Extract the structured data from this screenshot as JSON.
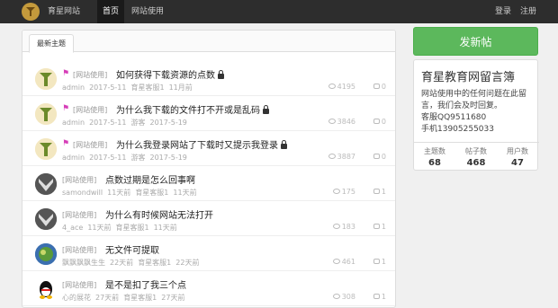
{
  "nav": {
    "brand": "育星网站",
    "home": "首页",
    "help": "网站使用",
    "login": "登录",
    "register": "注册"
  },
  "tabs": {
    "latest": "最新主题"
  },
  "topics": [
    {
      "category": "[网站使用]",
      "title": "如何获得下载资源的点数",
      "author": "admin",
      "date": "2017-5-11",
      "last_replier": "育星客服1",
      "ago": "11月前",
      "views": "4195",
      "replies": "0",
      "avatar": "tree",
      "flag": true,
      "lock": true
    },
    {
      "category": "[网站使用]",
      "title": "为什么我下载的文件打不开或是乱码",
      "author": "admin",
      "date": "2017-5-11",
      "last_replier": "游客",
      "ago": "2017-5-19",
      "views": "3846",
      "replies": "0",
      "avatar": "tree",
      "flag": true,
      "lock": true
    },
    {
      "category": "[网站使用]",
      "title": "为什么我登录网站了下载时又提示我登录",
      "author": "admin",
      "date": "2017-5-11",
      "last_replier": "游客",
      "ago": "2017-5-19",
      "views": "3887",
      "replies": "0",
      "avatar": "tree",
      "flag": true,
      "lock": true
    },
    {
      "category": "[网站使用]",
      "title": "点数过期是怎么回事啊",
      "author": "samondwill",
      "date": "11天前",
      "last_replier": "育星客服1",
      "ago": "11天前",
      "views": "175",
      "replies": "1",
      "avatar": "mask",
      "flag": false,
      "lock": false
    },
    {
      "category": "[网站使用]",
      "title": "为什么有时候网站无法打开",
      "author": "4_ace",
      "date": "11天前",
      "last_replier": "育星客服1",
      "ago": "11天前",
      "views": "183",
      "replies": "1",
      "avatar": "mask",
      "flag": false,
      "lock": false
    },
    {
      "category": "[网站使用]",
      "title": "无文件可提取",
      "author": "飘飘飘飘生生",
      "date": "22天前",
      "last_replier": "育星客服1",
      "ago": "22天前",
      "views": "461",
      "replies": "1",
      "avatar": "globe",
      "flag": false,
      "lock": false
    },
    {
      "category": "[网站使用]",
      "title": "是不是扣了我三个点",
      "author": "心的展花",
      "date": "27天前",
      "last_replier": "育星客服1",
      "ago": "27天前",
      "views": "308",
      "replies": "1",
      "avatar": "qq",
      "flag": false,
      "lock": false
    }
  ],
  "sidebar": {
    "new_post": "发新帖",
    "board_title": "育星教育网留言簿",
    "desc_line1": "网站使用中的任何问题在此留",
    "desc_line2": "言，我们会及时回复。",
    "desc_line3": "客服QQ9511680",
    "desc_line4": "手机13905255033",
    "stats": [
      {
        "label": "主题数",
        "value": "68"
      },
      {
        "label": "帖子数",
        "value": "468"
      },
      {
        "label": "用户数",
        "value": "47"
      }
    ]
  }
}
